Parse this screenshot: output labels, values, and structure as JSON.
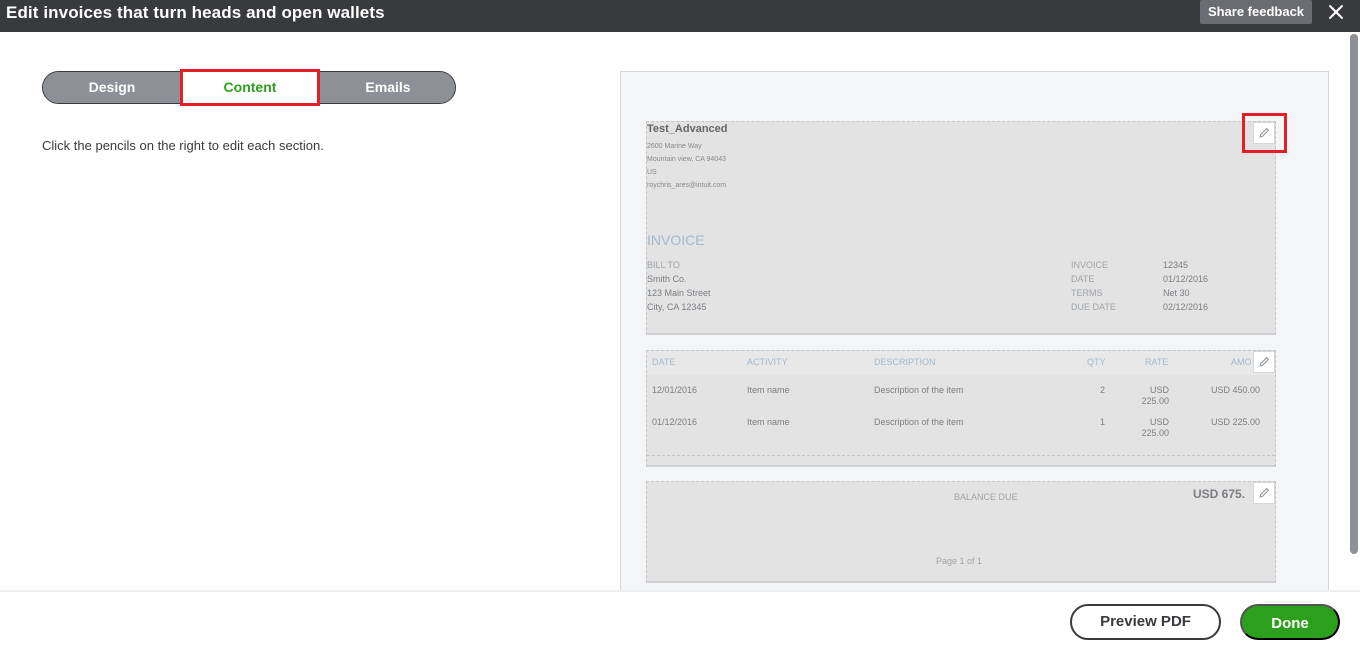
{
  "header": {
    "title": "Edit invoices that turn heads and open wallets",
    "share_feedback": "Share feedback",
    "close_icon": "close-icon"
  },
  "tabs": [
    {
      "label": "Design",
      "active": false
    },
    {
      "label": "Content",
      "active": true
    },
    {
      "label": "Emails",
      "active": false
    }
  ],
  "hint": "Click the pencils on the right to edit each section.",
  "invoice": {
    "company": {
      "name": "Test_Advanced",
      "address1": "2600 Marine Way",
      "address2": "Mountain view, CA 94043",
      "country": "US",
      "email": "roychris_ares@intuit.com"
    },
    "title": "INVOICE",
    "bill_to": {
      "label": "BILL TO",
      "name": "Smith Co.",
      "street": "123 Main Street",
      "city": "City, CA 12345"
    },
    "meta": [
      {
        "label": "INVOICE",
        "value": "12345"
      },
      {
        "label": "DATE",
        "value": "01/12/2016"
      },
      {
        "label": "TERMS",
        "value": "Net 30"
      },
      {
        "label": "DUE DATE",
        "value": "02/12/2016"
      }
    ],
    "columns": {
      "date": "DATE",
      "activity": "ACTIVITY",
      "description": "DESCRIPTION",
      "qty": "QTY",
      "rate": "RATE",
      "amount": "AMO"
    },
    "rows": [
      {
        "date": "12/01/2016",
        "activity": "Item name",
        "description": "Description of the item",
        "qty": "2",
        "rate_l1": "USD",
        "rate_l2": "225.00",
        "amount": "USD 450.00"
      },
      {
        "date": "01/12/2016",
        "activity": "Item name",
        "description": "Description of the item",
        "qty": "1",
        "rate_l1": "USD",
        "rate_l2": "225.00",
        "amount": "USD 225.00"
      }
    ],
    "balance_due_label": "BALANCE DUE",
    "balance_due_value": "USD 675.",
    "page_info": "Page 1 of 1"
  },
  "footer": {
    "preview_pdf": "Preview PDF",
    "done": "Done"
  },
  "colors": {
    "accent_green": "#2ca01c",
    "highlight_red": "#e41e26",
    "topbar": "#393a3d"
  }
}
